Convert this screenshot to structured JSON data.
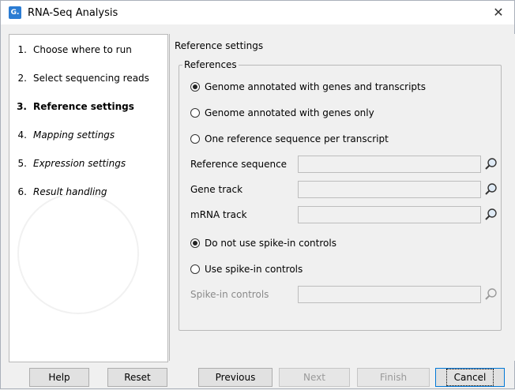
{
  "window": {
    "title": "RNA-Seq Analysis",
    "close_glyph": "✕",
    "app_icon": "clc-logo-icon"
  },
  "steps": [
    {
      "num": "1.",
      "label": "Choose where to run",
      "state": "done"
    },
    {
      "num": "2.",
      "label": "Select sequencing reads",
      "state": "done"
    },
    {
      "num": "3.",
      "label": "Reference settings",
      "state": "current"
    },
    {
      "num": "4.",
      "label": "Mapping settings",
      "state": "future"
    },
    {
      "num": "5.",
      "label": "Expression settings",
      "state": "future"
    },
    {
      "num": "6.",
      "label": "Result handling",
      "state": "future"
    }
  ],
  "panel": {
    "section_title": "Reference settings",
    "group_title": "References",
    "reference_options": [
      {
        "label": "Genome annotated with genes and transcripts",
        "selected": true
      },
      {
        "label": "Genome annotated with genes only",
        "selected": false
      },
      {
        "label": "One reference sequence per transcript",
        "selected": false
      }
    ],
    "fields": [
      {
        "label": "Reference sequence",
        "value": "",
        "enabled": true
      },
      {
        "label": "Gene track",
        "value": "",
        "enabled": true
      },
      {
        "label": "mRNA track",
        "value": "",
        "enabled": true
      }
    ],
    "spike_options": [
      {
        "label": "Do not use spike-in controls",
        "selected": true
      },
      {
        "label": "Use spike-in controls",
        "selected": false
      }
    ],
    "spike_field": {
      "label": "Spike-in controls",
      "value": "",
      "enabled": false
    }
  },
  "buttons": {
    "help": "Help",
    "reset": "Reset",
    "previous": "Previous",
    "next": "Next",
    "finish": "Finish",
    "cancel": "Cancel"
  },
  "colors": {
    "accent": "#2b7cd3",
    "default_button_border": "#0078d7"
  }
}
